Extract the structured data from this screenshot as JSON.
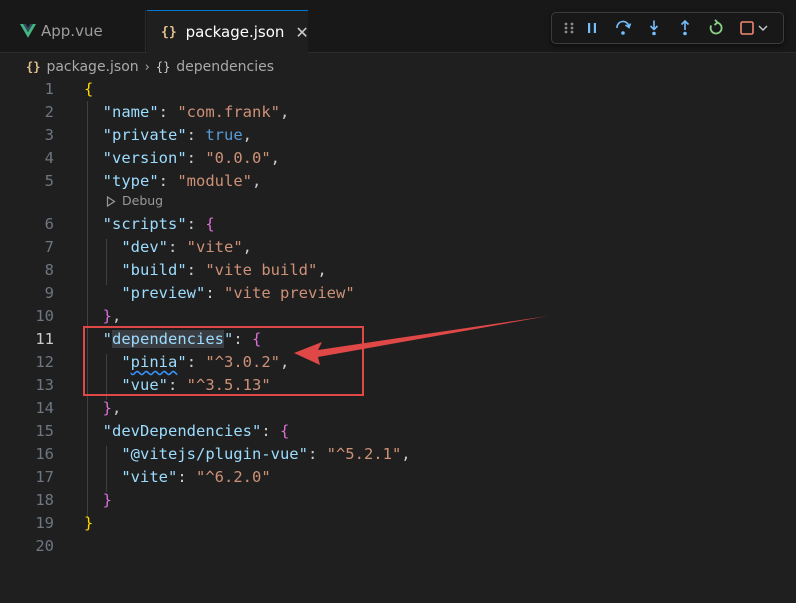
{
  "tabs": [
    {
      "label": "App.vue",
      "icon": "vue-icon",
      "active": false
    },
    {
      "label": "package.json",
      "icon": "json-braces-icon",
      "active": true
    }
  ],
  "tab_close_glyph": "✕",
  "breadcrumb": {
    "file": "package.json",
    "separator": "›",
    "section": "dependencies",
    "file_icon": "{}",
    "section_icon": "{}"
  },
  "codelens": {
    "label": "Debug"
  },
  "colors": {
    "background": "#1f1f1f",
    "key": "#9cdcfe",
    "string": "#ce9178",
    "keyword": "#569cd6",
    "bracket_gold": "#ffd700",
    "bracket_pink": "#da70d6",
    "annotation_red": "#e04848",
    "debug_green": "#89d185",
    "debug_blue": "#75beff",
    "debug_stop": "#f48771"
  },
  "debug_toolbar": [
    {
      "name": "drag-handle-icon"
    },
    {
      "name": "pause-icon"
    },
    {
      "name": "step-over-icon"
    },
    {
      "name": "step-into-icon"
    },
    {
      "name": "step-out-icon"
    },
    {
      "name": "restart-icon"
    },
    {
      "name": "stop-icon"
    },
    {
      "name": "chevron-down-icon"
    }
  ],
  "active_line": 11,
  "lines": [
    {
      "n": "1",
      "tokens": [
        [
          "b1",
          "{"
        ]
      ]
    },
    {
      "n": "2",
      "tokens": [
        [
          "p",
          "  "
        ],
        [
          "k",
          "\"name\""
        ],
        [
          "p",
          ": "
        ],
        [
          "s",
          "\"com.frank\""
        ],
        [
          "p",
          ","
        ]
      ]
    },
    {
      "n": "3",
      "tokens": [
        [
          "p",
          "  "
        ],
        [
          "k",
          "\"private\""
        ],
        [
          "p",
          ": "
        ],
        [
          "kw",
          "true"
        ],
        [
          "p",
          ","
        ]
      ]
    },
    {
      "n": "4",
      "tokens": [
        [
          "p",
          "  "
        ],
        [
          "k",
          "\"version\""
        ],
        [
          "p",
          ": "
        ],
        [
          "s",
          "\"0.0.0\""
        ],
        [
          "p",
          ","
        ]
      ]
    },
    {
      "n": "5",
      "tokens": [
        [
          "p",
          "  "
        ],
        [
          "k",
          "\"type\""
        ],
        [
          "p",
          ": "
        ],
        [
          "s",
          "\"module\""
        ],
        [
          "p",
          ","
        ]
      ]
    },
    {
      "n": "6",
      "tokens": [
        [
          "p",
          "  "
        ],
        [
          "k",
          "\"scripts\""
        ],
        [
          "p",
          ": "
        ],
        [
          "b2",
          "{"
        ]
      ]
    },
    {
      "n": "7",
      "tokens": [
        [
          "p",
          "    "
        ],
        [
          "k",
          "\"dev\""
        ],
        [
          "p",
          ": "
        ],
        [
          "s",
          "\"vite\""
        ],
        [
          "p",
          ","
        ]
      ]
    },
    {
      "n": "8",
      "tokens": [
        [
          "p",
          "    "
        ],
        [
          "k",
          "\"build\""
        ],
        [
          "p",
          ": "
        ],
        [
          "s",
          "\"vite build\""
        ],
        [
          "p",
          ","
        ]
      ]
    },
    {
      "n": "9",
      "tokens": [
        [
          "p",
          "    "
        ],
        [
          "k",
          "\"preview\""
        ],
        [
          "p",
          ": "
        ],
        [
          "s",
          "\"vite preview\""
        ]
      ]
    },
    {
      "n": "10",
      "tokens": [
        [
          "p",
          "  "
        ],
        [
          "b2",
          "}"
        ],
        [
          "p",
          ","
        ]
      ]
    },
    {
      "n": "11",
      "tokens": [
        [
          "p",
          "  "
        ],
        [
          "k",
          "\""
        ],
        [
          "khl",
          "dependencies"
        ],
        [
          "k",
          "\""
        ],
        [
          "p",
          ": "
        ],
        [
          "b2",
          "{"
        ]
      ]
    },
    {
      "n": "12",
      "tokens": [
        [
          "p",
          "    "
        ],
        [
          "k",
          "\""
        ],
        [
          "ksq",
          "pinia"
        ],
        [
          "k",
          "\""
        ],
        [
          "p",
          ": "
        ],
        [
          "s",
          "\"^3.0.2\""
        ],
        [
          "p",
          ","
        ]
      ]
    },
    {
      "n": "13",
      "tokens": [
        [
          "p",
          "    "
        ],
        [
          "k",
          "\"vue\""
        ],
        [
          "p",
          ": "
        ],
        [
          "s",
          "\"^3.5.13\""
        ]
      ]
    },
    {
      "n": "14",
      "tokens": [
        [
          "p",
          "  "
        ],
        [
          "b2",
          "}"
        ],
        [
          "p",
          ","
        ]
      ]
    },
    {
      "n": "15",
      "tokens": [
        [
          "p",
          "  "
        ],
        [
          "k",
          "\"devDependencies\""
        ],
        [
          "p",
          ": "
        ],
        [
          "b2",
          "{"
        ]
      ]
    },
    {
      "n": "16",
      "tokens": [
        [
          "p",
          "    "
        ],
        [
          "k",
          "\"@vitejs/plugin-vue\""
        ],
        [
          "p",
          ": "
        ],
        [
          "s",
          "\"^5.2.1\""
        ],
        [
          "p",
          ","
        ]
      ]
    },
    {
      "n": "17",
      "tokens": [
        [
          "p",
          "    "
        ],
        [
          "k",
          "\"vite\""
        ],
        [
          "p",
          ": "
        ],
        [
          "s",
          "\"^6.2.0\""
        ]
      ]
    },
    {
      "n": "18",
      "tokens": [
        [
          "p",
          "  "
        ],
        [
          "b2",
          "}"
        ]
      ]
    },
    {
      "n": "19",
      "tokens": [
        [
          "b1",
          "}"
        ]
      ]
    },
    {
      "n": "20",
      "tokens": []
    }
  ]
}
